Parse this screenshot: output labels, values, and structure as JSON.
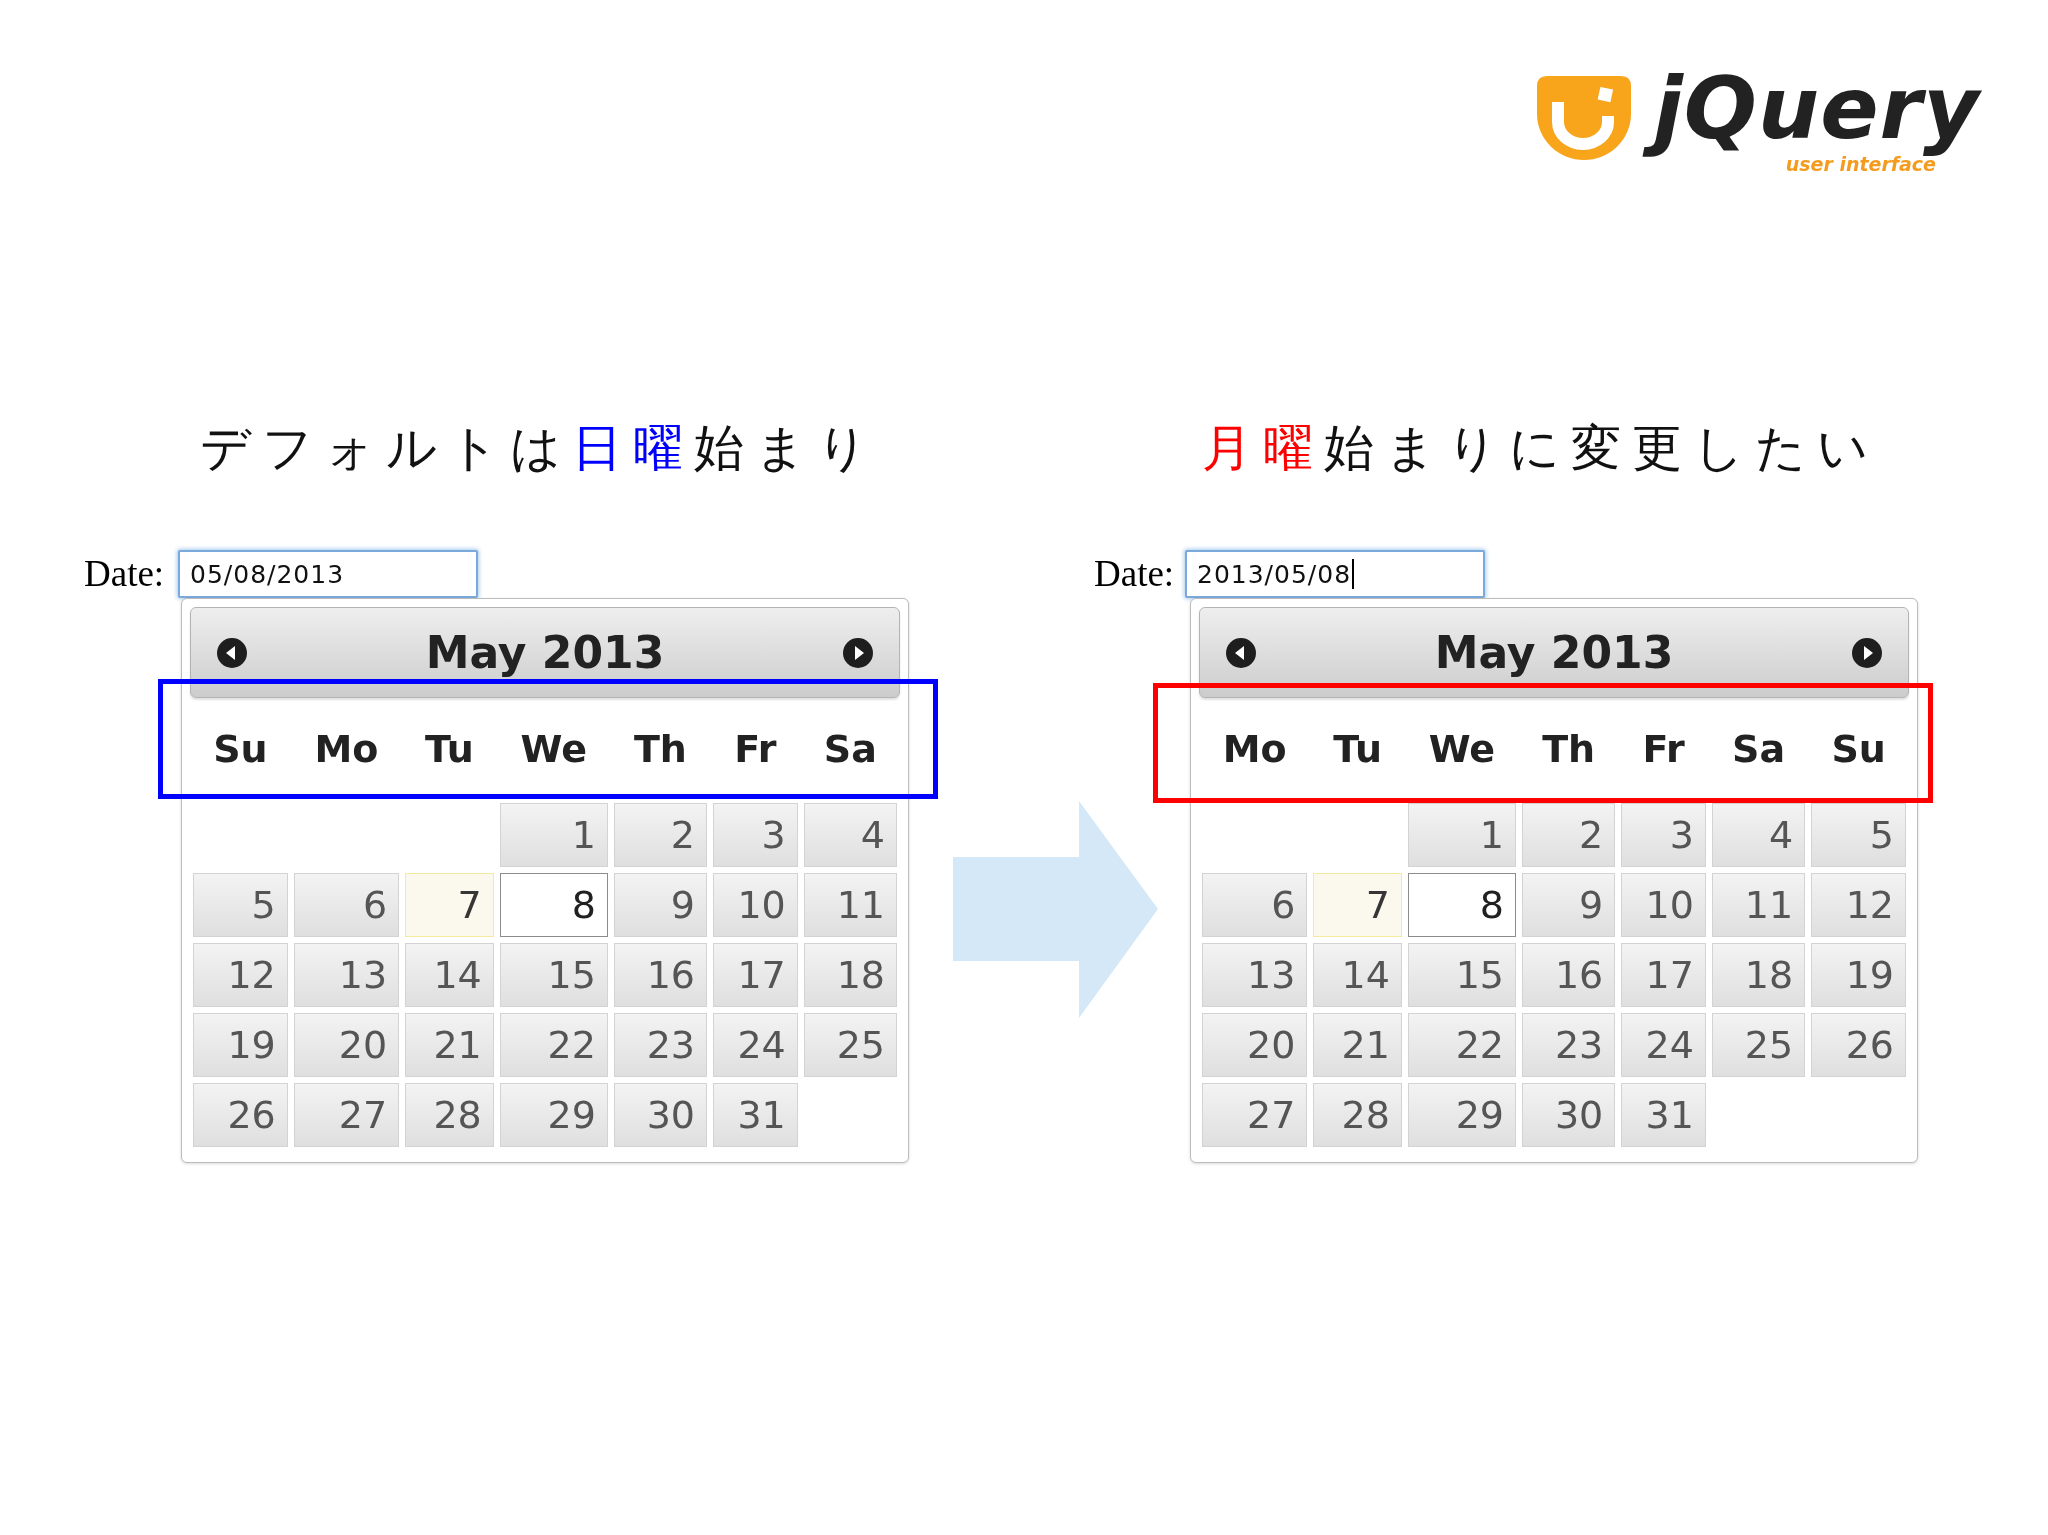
{
  "logo": {
    "wordmark": "jQuery",
    "tagline": "user interface"
  },
  "panels": [
    {
      "color": "#0000ff",
      "title": [
        {
          "text": "デフォルトは",
          "highlight": false
        },
        {
          "text": "日曜",
          "highlight": true
        },
        {
          "text": "始まり",
          "highlight": false
        }
      ],
      "date_label": "Date:",
      "date_input": {
        "value": "05/08/2013",
        "caret": false
      },
      "calendar": {
        "month": "May 2013",
        "weekdays": [
          "Su",
          "Mo",
          "Tu",
          "We",
          "Th",
          "Fr",
          "Sa"
        ],
        "weeks": [
          [
            {
              "kind": "blank"
            },
            {
              "kind": "blank"
            },
            {
              "kind": "blank"
            },
            {
              "kind": "day",
              "day": "1",
              "selected": false,
              "today": false
            },
            {
              "kind": "day",
              "day": "2",
              "selected": false,
              "today": false
            },
            {
              "kind": "day",
              "day": "3",
              "selected": false,
              "today": false
            },
            {
              "kind": "day",
              "day": "4",
              "selected": false,
              "today": false
            }
          ],
          [
            {
              "kind": "day",
              "day": "5",
              "selected": false,
              "today": false
            },
            {
              "kind": "day",
              "day": "6",
              "selected": false,
              "today": false
            },
            {
              "kind": "day",
              "day": "7",
              "selected": false,
              "today": true
            },
            {
              "kind": "day",
              "day": "8",
              "selected": true,
              "today": false
            },
            {
              "kind": "day",
              "day": "9",
              "selected": false,
              "today": false
            },
            {
              "kind": "day",
              "day": "10",
              "selected": false,
              "today": false
            },
            {
              "kind": "day",
              "day": "11",
              "selected": false,
              "today": false
            }
          ],
          [
            {
              "kind": "day",
              "day": "12",
              "selected": false,
              "today": false
            },
            {
              "kind": "day",
              "day": "13",
              "selected": false,
              "today": false
            },
            {
              "kind": "day",
              "day": "14",
              "selected": false,
              "today": false
            },
            {
              "kind": "day",
              "day": "15",
              "selected": false,
              "today": false
            },
            {
              "kind": "day",
              "day": "16",
              "selected": false,
              "today": false
            },
            {
              "kind": "day",
              "day": "17",
              "selected": false,
              "today": false
            },
            {
              "kind": "day",
              "day": "18",
              "selected": false,
              "today": false
            }
          ],
          [
            {
              "kind": "day",
              "day": "19",
              "selected": false,
              "today": false
            },
            {
              "kind": "day",
              "day": "20",
              "selected": false,
              "today": false
            },
            {
              "kind": "day",
              "day": "21",
              "selected": false,
              "today": false
            },
            {
              "kind": "day",
              "day": "22",
              "selected": false,
              "today": false
            },
            {
              "kind": "day",
              "day": "23",
              "selected": false,
              "today": false
            },
            {
              "kind": "day",
              "day": "24",
              "selected": false,
              "today": false
            },
            {
              "kind": "day",
              "day": "25",
              "selected": false,
              "today": false
            }
          ],
          [
            {
              "kind": "day",
              "day": "26",
              "selected": false,
              "today": false
            },
            {
              "kind": "day",
              "day": "27",
              "selected": false,
              "today": false
            },
            {
              "kind": "day",
              "day": "28",
              "selected": false,
              "today": false
            },
            {
              "kind": "day",
              "day": "29",
              "selected": false,
              "today": false
            },
            {
              "kind": "day",
              "day": "30",
              "selected": false,
              "today": false
            },
            {
              "kind": "day",
              "day": "31",
              "selected": false,
              "today": false
            },
            {
              "kind": "blank"
            }
          ]
        ]
      }
    },
    {
      "color": "#ff0000",
      "title": [
        {
          "text": "月曜",
          "highlight": true
        },
        {
          "text": "始まりに変更したい",
          "highlight": false
        }
      ],
      "date_label": "Date:",
      "date_input": {
        "value": "2013/05/08",
        "caret": true
      },
      "calendar": {
        "month": "May 2013",
        "weekdays": [
          "Mo",
          "Tu",
          "We",
          "Th",
          "Fr",
          "Sa",
          "Su"
        ],
        "weeks": [
          [
            {
              "kind": "blank"
            },
            {
              "kind": "blank"
            },
            {
              "kind": "day",
              "day": "1",
              "selected": false,
              "today": false
            },
            {
              "kind": "day",
              "day": "2",
              "selected": false,
              "today": false
            },
            {
              "kind": "day",
              "day": "3",
              "selected": false,
              "today": false
            },
            {
              "kind": "day",
              "day": "4",
              "selected": false,
              "today": false
            },
            {
              "kind": "day",
              "day": "5",
              "selected": false,
              "today": false
            }
          ],
          [
            {
              "kind": "day",
              "day": "6",
              "selected": false,
              "today": false
            },
            {
              "kind": "day",
              "day": "7",
              "selected": false,
              "today": true
            },
            {
              "kind": "day",
              "day": "8",
              "selected": true,
              "today": false
            },
            {
              "kind": "day",
              "day": "9",
              "selected": false,
              "today": false
            },
            {
              "kind": "day",
              "day": "10",
              "selected": false,
              "today": false
            },
            {
              "kind": "day",
              "day": "11",
              "selected": false,
              "today": false
            },
            {
              "kind": "day",
              "day": "12",
              "selected": false,
              "today": false
            }
          ],
          [
            {
              "kind": "day",
              "day": "13",
              "selected": false,
              "today": false
            },
            {
              "kind": "day",
              "day": "14",
              "selected": false,
              "today": false
            },
            {
              "kind": "day",
              "day": "15",
              "selected": false,
              "today": false
            },
            {
              "kind": "day",
              "day": "16",
              "selected": false,
              "today": false
            },
            {
              "kind": "day",
              "day": "17",
              "selected": false,
              "today": false
            },
            {
              "kind": "day",
              "day": "18",
              "selected": false,
              "today": false
            },
            {
              "kind": "day",
              "day": "19",
              "selected": false,
              "today": false
            }
          ],
          [
            {
              "kind": "day",
              "day": "20",
              "selected": false,
              "today": false
            },
            {
              "kind": "day",
              "day": "21",
              "selected": false,
              "today": false
            },
            {
              "kind": "day",
              "day": "22",
              "selected": false,
              "today": false
            },
            {
              "kind": "day",
              "day": "23",
              "selected": false,
              "today": false
            },
            {
              "kind": "day",
              "day": "24",
              "selected": false,
              "today": false
            },
            {
              "kind": "day",
              "day": "25",
              "selected": false,
              "today": false
            },
            {
              "kind": "day",
              "day": "26",
              "selected": false,
              "today": false
            }
          ],
          [
            {
              "kind": "day",
              "day": "27",
              "selected": false,
              "today": false
            },
            {
              "kind": "day",
              "day": "28",
              "selected": false,
              "today": false
            },
            {
              "kind": "day",
              "day": "29",
              "selected": false,
              "today": false
            },
            {
              "kind": "day",
              "day": "30",
              "selected": false,
              "today": false
            },
            {
              "kind": "day",
              "day": "31",
              "selected": false,
              "today": false
            },
            {
              "kind": "blank"
            },
            {
              "kind": "blank"
            }
          ]
        ]
      }
    }
  ]
}
